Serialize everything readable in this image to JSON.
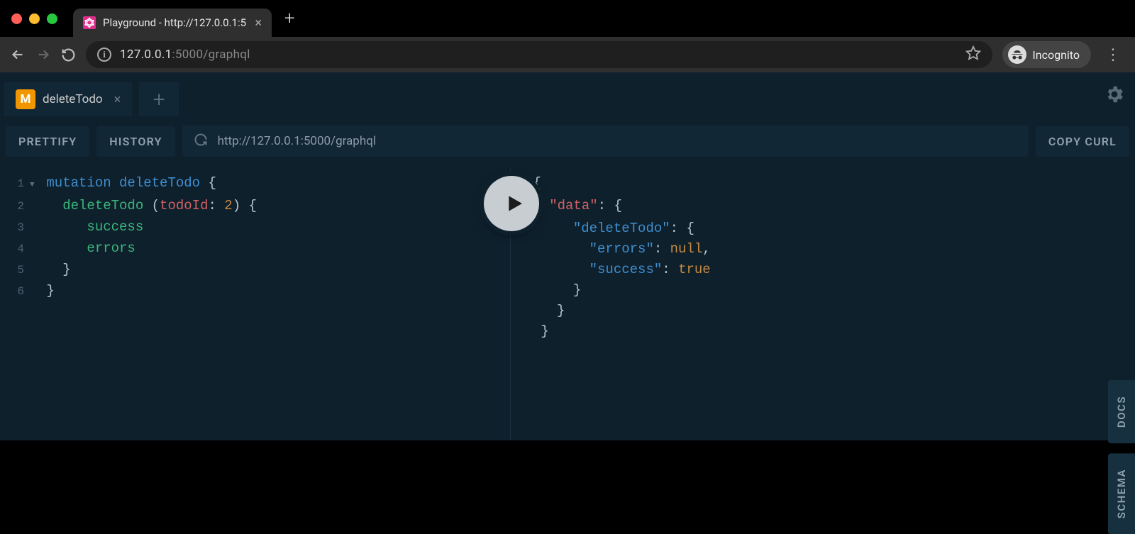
{
  "browser": {
    "tab_title": "Playground - http://127.0.0.1:5",
    "url_host": "127.0.0.1",
    "url_port_path": ":5000/graphql",
    "incognito_label": "Incognito"
  },
  "playground": {
    "tab": {
      "badge_letter": "M",
      "name": "deleteTodo"
    },
    "buttons": {
      "prettify": "Prettify",
      "history": "History",
      "copy_curl": "Copy CURL"
    },
    "endpoint": "http://127.0.0.1:5000/graphql",
    "side_tabs": {
      "docs": "DOCS",
      "schema": "SCHEMA"
    },
    "query": {
      "line1_kw": "mutation",
      "line1_name": "deleteTodo",
      "line2_field": "deleteTodo",
      "line2_arg": "todoId",
      "line2_val": "2",
      "line3": "success",
      "line4": "errors",
      "lineno": {
        "l1": "1",
        "l2": "2",
        "l3": "3",
        "l4": "4",
        "l5": "5",
        "l6": "6"
      }
    },
    "response": {
      "k_data": "\"data\"",
      "k_deleteTodo": "\"deleteTodo\"",
      "k_errors": "\"errors\"",
      "v_errors": "null",
      "k_success": "\"success\"",
      "v_success": "true"
    }
  }
}
